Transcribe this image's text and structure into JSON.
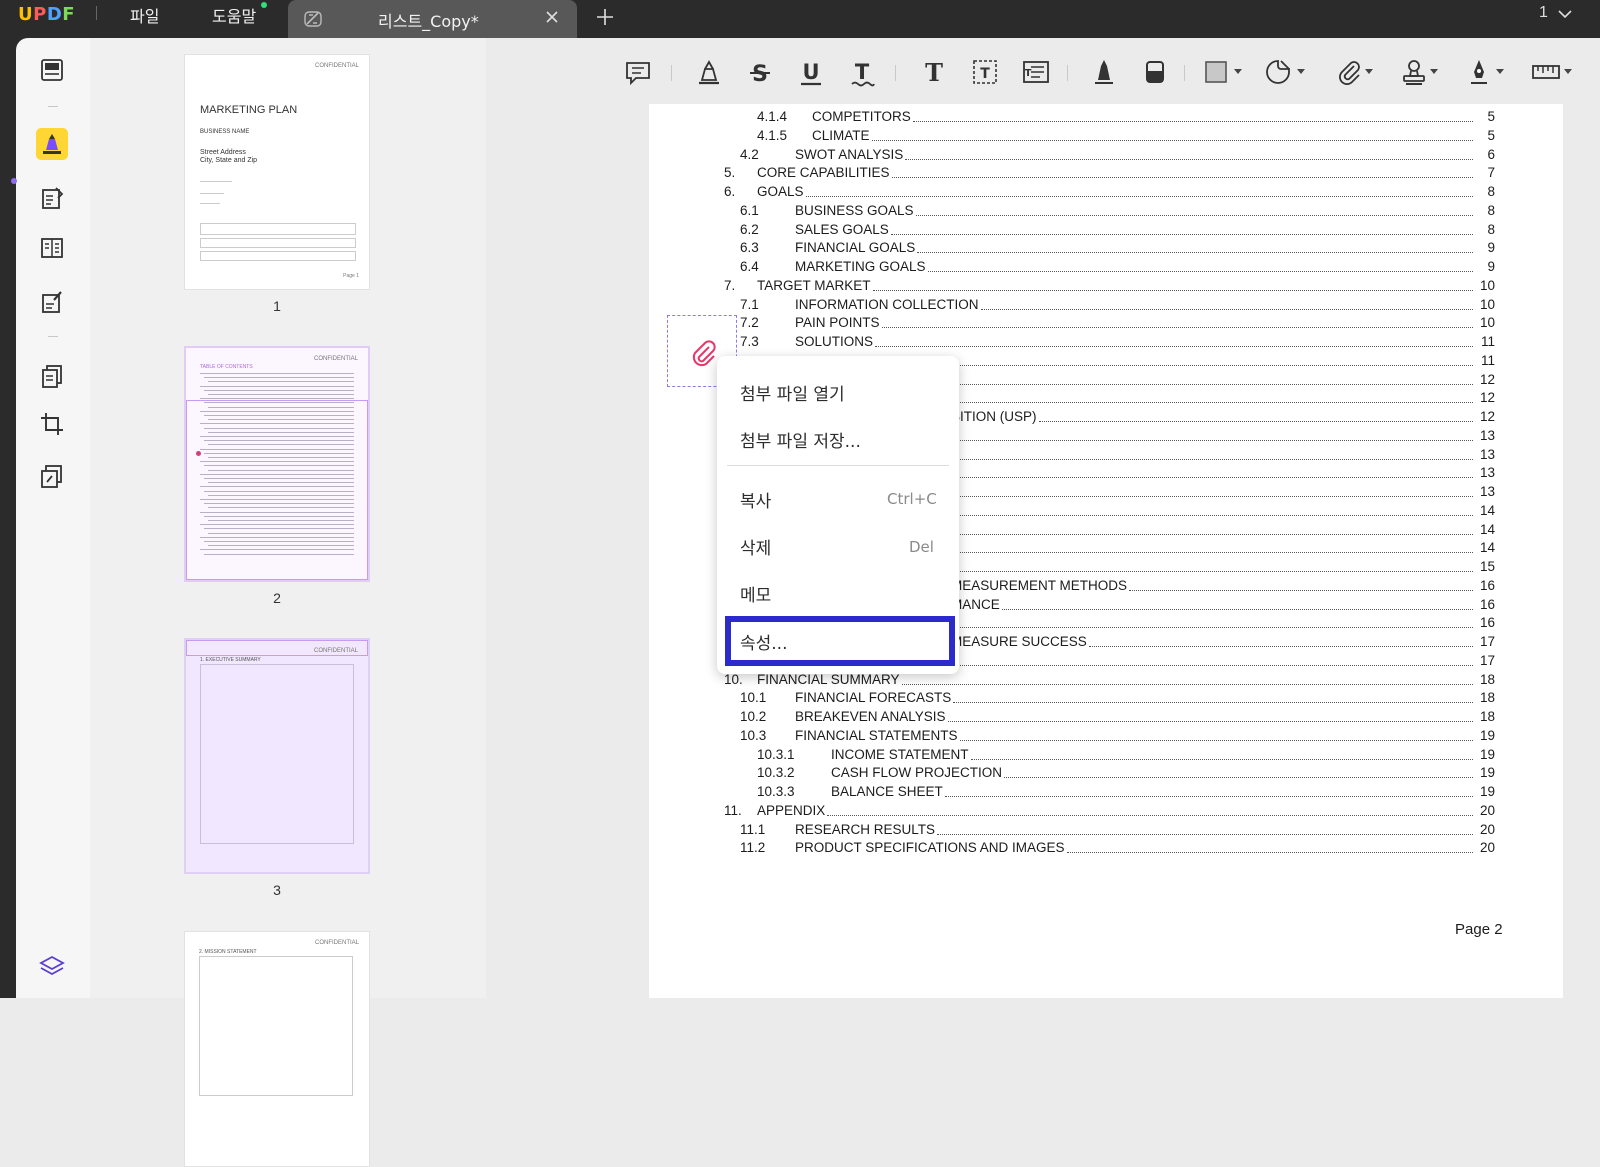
{
  "app": {
    "logo_text": "UPDF",
    "menu": [
      {
        "label": "파일"
      },
      {
        "label": "도움말"
      }
    ],
    "tab": {
      "title": "리스트_Copy*"
    },
    "page_indicator": "1"
  },
  "colors": {
    "accent": "#8e6cf0",
    "menu_highlight": "#2c2bc9",
    "titlebar": "#2b2b2b"
  },
  "left_toolbar": {
    "tools": [
      {
        "icon": "reader-icon"
      },
      {
        "icon": "comment-highlighter-icon",
        "active": true
      },
      {
        "icon": "edit-pdf-icon"
      },
      {
        "icon": "form-icon"
      },
      {
        "icon": "fill-sign-icon"
      },
      {
        "icon": "organize-pages-icon"
      },
      {
        "icon": "crop-icon"
      },
      {
        "icon": "page-tools-icon"
      },
      {
        "icon": "layers-icon"
      }
    ]
  },
  "thumbnails": {
    "pages": [
      {
        "label": "1"
      },
      {
        "label": "2",
        "selected": true
      },
      {
        "label": "3"
      }
    ],
    "page1": {
      "confidential": "CONFIDENTIAL",
      "title": "MARKETING PLAN",
      "business": "BUSINESS NAME",
      "address1": "Street Address",
      "address2": "City, State and Zip",
      "page": "Page 1"
    },
    "page2": {
      "confidential": "CONFIDENTIAL",
      "heading": "TABLE OF CONTENTS"
    },
    "page3": {
      "confidential": "CONFIDENTIAL",
      "heading": "1. EXECUTIVE SUMMARY"
    },
    "page4": {
      "confidential": "CONFIDENTIAL",
      "heading": "2. MISSION STATEMENT"
    }
  },
  "annotation_toolbar": {
    "tools": [
      "comment-icon",
      "highlight-icon",
      "strikethrough-icon",
      "underline-icon",
      "squiggly-icon",
      "text-icon",
      "textbox-icon",
      "text-callout-icon",
      "pencil-icon",
      "eraser-icon",
      "shape-icon",
      "sticker-icon",
      "attachment-icon",
      "stamp-icon",
      "signature-icon",
      "measure-icon"
    ]
  },
  "toc": [
    {
      "num": "4.1.4",
      "title": "COMPETITORS",
      "page": "5"
    },
    {
      "num": "4.1.5",
      "title": "CLIMATE",
      "page": "5"
    },
    {
      "num": "4.2",
      "title": "SWOT ANALYSIS",
      "page": "6"
    },
    {
      "num": "5.",
      "title": "CORE CAPABILITIES",
      "page": "7"
    },
    {
      "num": "6.",
      "title": "GOALS",
      "page": "8"
    },
    {
      "num": "6.1",
      "title": "BUSINESS GOALS",
      "page": "8"
    },
    {
      "num": "6.2",
      "title": "SALES GOALS",
      "page": "8"
    },
    {
      "num": "6.3",
      "title": "FINANCIAL GOALS",
      "page": "9"
    },
    {
      "num": "6.4",
      "title": "MARKETING GOALS",
      "page": "9"
    },
    {
      "num": "7.",
      "title": "TARGET MARKET",
      "page": "10"
    },
    {
      "num": "7.1",
      "title": "INFORMATION COLLECTION",
      "page": "10"
    },
    {
      "num": "7.2",
      "title": "PAIN POINTS",
      "page": "10"
    },
    {
      "num": "7.3",
      "title": "SOLUTIONS",
      "page": "11"
    },
    {
      "num": "",
      "title": "",
      "page": "11"
    },
    {
      "num": "",
      "title": "",
      "page": "12"
    },
    {
      "num": "",
      "title": "",
      "page": "12"
    },
    {
      "num": "",
      "title": "SITION (USP)",
      "page": "12"
    },
    {
      "num": "",
      "title": "",
      "page": "13"
    },
    {
      "num": "",
      "title": "",
      "page": "13"
    },
    {
      "num": "",
      "title": "",
      "page": "13"
    },
    {
      "num": "",
      "title": "",
      "page": "13"
    },
    {
      "num": "",
      "title": "",
      "page": "14"
    },
    {
      "num": "",
      "title": "",
      "page": "14"
    },
    {
      "num": "",
      "title": "",
      "page": "14"
    },
    {
      "num": "",
      "title": "",
      "page": "15"
    },
    {
      "num": "",
      "title": "MEASUREMENT METHODS",
      "page": "16"
    },
    {
      "num": "",
      "title": "MANCE",
      "page": "16"
    },
    {
      "num": "",
      "title": "",
      "page": "16"
    },
    {
      "num": "",
      "title": "MEASURE SUCCESS",
      "page": "17"
    },
    {
      "num": "",
      "title": "",
      "page": "17"
    },
    {
      "num": "10.",
      "title": "FINANCIAL SUMMARY",
      "page": "18"
    },
    {
      "num": "10.1",
      "title": "FINANCIAL FORECASTS",
      "page": "18"
    },
    {
      "num": "10.2",
      "title": "BREAKEVEN ANALYSIS",
      "page": "18"
    },
    {
      "num": "10.3",
      "title": "FINANCIAL STATEMENTS",
      "page": "19"
    },
    {
      "num": "10.3.1",
      "title": "INCOME STATEMENT",
      "page": "19"
    },
    {
      "num": "10.3.2",
      "title": "CASH FLOW PROJECTION",
      "page": "19"
    },
    {
      "num": "10.3.3",
      "title": "BALANCE SHEET",
      "page": "19"
    },
    {
      "num": "11.",
      "title": "APPENDIX",
      "page": "20"
    },
    {
      "num": "11.1",
      "title": "RESEARCH RESULTS",
      "page": "20"
    },
    {
      "num": "11.2",
      "title": "PRODUCT SPECIFICATIONS AND IMAGES",
      "page": "20"
    }
  ],
  "page_footer": "Page 2",
  "context_menu": {
    "items": [
      {
        "label": "첨부 파일 열기",
        "shortcut": ""
      },
      {
        "label": "첨부 파일 저장...",
        "shortcut": ""
      },
      {
        "label": "복사",
        "shortcut": "Ctrl+C"
      },
      {
        "label": "삭제",
        "shortcut": "Del"
      },
      {
        "label": "메모",
        "shortcut": ""
      },
      {
        "label": "속성...",
        "shortcut": "",
        "highlighted": true
      }
    ]
  }
}
